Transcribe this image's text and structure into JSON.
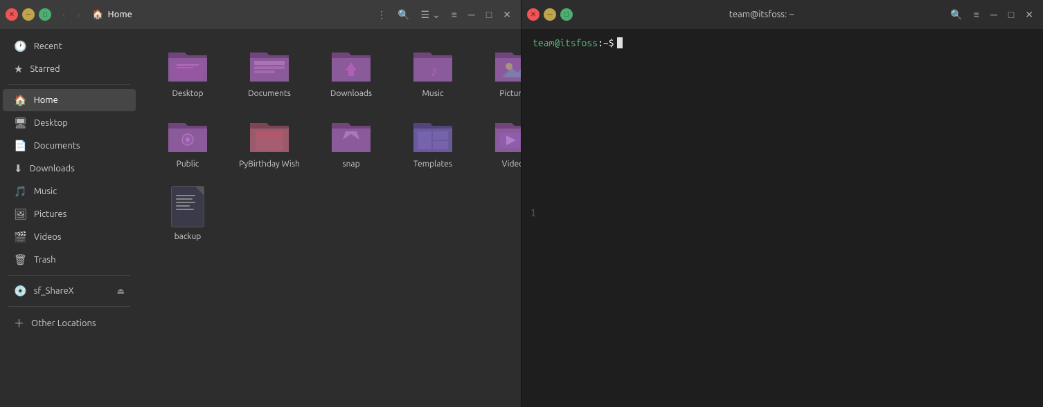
{
  "fileManager": {
    "titlebar": {
      "title": "Home",
      "backBtn": "‹",
      "forwardBtn": "›",
      "menuBtn": "⋮",
      "searchBtn": "🔍",
      "viewToggle": "☰",
      "viewChevron": "⌄",
      "sortBtn": "≡",
      "minimizeBtn": "─",
      "maximizeBtn": "□",
      "closeBtn": "✕"
    },
    "sidebar": {
      "items": [
        {
          "id": "recent",
          "label": "Recent",
          "icon": "🕐"
        },
        {
          "id": "starred",
          "label": "Starred",
          "icon": "★"
        },
        {
          "id": "home",
          "label": "Home",
          "icon": "🏠",
          "active": true
        },
        {
          "id": "desktop",
          "label": "Desktop",
          "icon": "🖥"
        },
        {
          "id": "documents",
          "label": "Documents",
          "icon": "📄"
        },
        {
          "id": "downloads",
          "label": "Downloads",
          "icon": "⬇"
        },
        {
          "id": "music",
          "label": "Music",
          "icon": "🎵"
        },
        {
          "id": "pictures",
          "label": "Pictures",
          "icon": "🖼"
        },
        {
          "id": "videos",
          "label": "Videos",
          "icon": "🎬"
        },
        {
          "id": "trash",
          "label": "Trash",
          "icon": "🗑"
        },
        {
          "id": "sf_sharex",
          "label": "sf_ShareX",
          "icon": "💿",
          "hasEject": true
        },
        {
          "id": "other-locations",
          "label": "Other Locations",
          "icon": "+"
        }
      ]
    },
    "files": [
      {
        "id": "desktop",
        "label": "Desktop",
        "type": "folder"
      },
      {
        "id": "documents",
        "label": "Documents",
        "type": "folder"
      },
      {
        "id": "downloads",
        "label": "Downloads",
        "type": "folder"
      },
      {
        "id": "music",
        "label": "Music",
        "type": "folder"
      },
      {
        "id": "pictures",
        "label": "Pictures",
        "type": "folder"
      },
      {
        "id": "public",
        "label": "Public",
        "type": "folder"
      },
      {
        "id": "pybirthday",
        "label": "PyBirthday Wish",
        "type": "folder"
      },
      {
        "id": "snap",
        "label": "snap",
        "type": "folder"
      },
      {
        "id": "templates",
        "label": "Templates",
        "type": "folder"
      },
      {
        "id": "videos",
        "label": "Videos",
        "type": "folder"
      },
      {
        "id": "backup",
        "label": "backup",
        "type": "text-file"
      }
    ]
  },
  "terminal": {
    "title": "team@itsfoss: ~",
    "prompt": "team@itsfoss:~$ ",
    "promptUser": "team@itsfoss",
    "promptSep": ":",
    "promptPath": "~",
    "promptDollar": "$",
    "lineNumber": "1"
  }
}
